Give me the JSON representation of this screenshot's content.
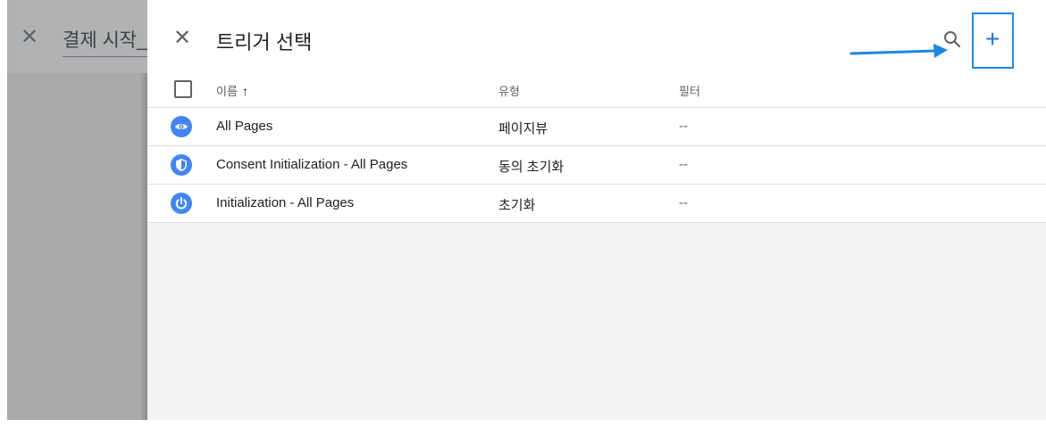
{
  "background_panel": {
    "title": "결제 시작_",
    "close_icon": "close-icon"
  },
  "drawer": {
    "title": "트리거 선택",
    "close_icon": "close-icon",
    "search_icon": "search-icon",
    "add_label": "+",
    "annotation_color": "#1e88e5"
  },
  "table": {
    "columns": {
      "name": "이름",
      "type": "유형",
      "filter": "필터"
    },
    "sort_direction": "ascending",
    "rows": [
      {
        "icon": "eye-icon",
        "name": "All Pages",
        "type": "페이지뷰",
        "filter": "--"
      },
      {
        "icon": "shield-icon",
        "name": "Consent Initialization - All Pages",
        "type": "동의 초기화",
        "filter": "--"
      },
      {
        "icon": "power-icon",
        "name": "Initialization - All Pages",
        "type": "초기화",
        "filter": "--"
      }
    ]
  },
  "colors": {
    "accent": "#1a73e8",
    "icon_blue": "#4285f4",
    "overlay_gray": "#a9aaab",
    "drawer_bg": "#f1f3f4"
  }
}
